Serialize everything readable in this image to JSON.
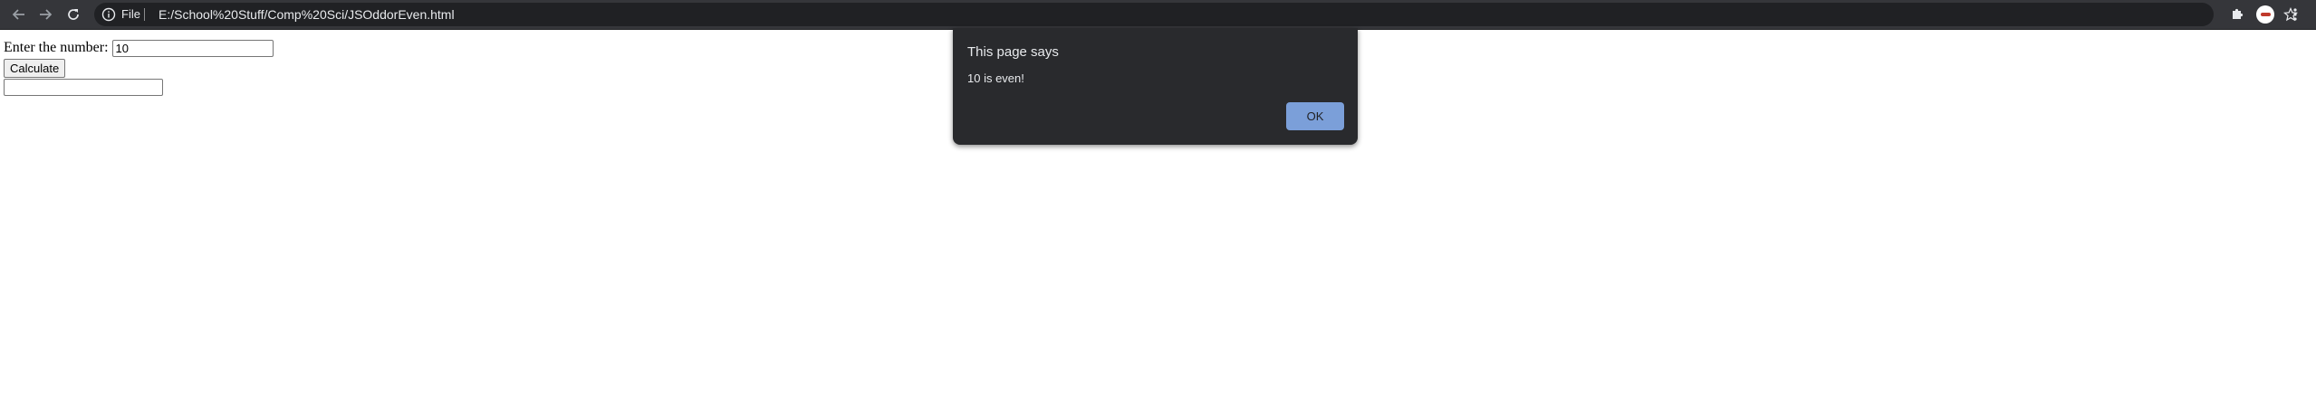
{
  "browser": {
    "file_label": "File",
    "url": "E:/School%20Stuff/Comp%20Sci/JSOddorEven.html"
  },
  "page": {
    "prompt_label": "Enter the number:",
    "number_value": "10",
    "calculate_label": "Calculate",
    "result_value": ""
  },
  "dialog": {
    "title": "This page says",
    "message": "10 is even!",
    "ok_label": "OK"
  },
  "colors": {
    "toolbar": "#35363a",
    "omnibox": "#202124",
    "dialog_bg": "#292a2d",
    "ok_button": "#8ab4f8"
  },
  "icons": [
    "back-arrow-icon",
    "forward-arrow-icon",
    "reload-icon",
    "info-icon",
    "star-icon",
    "extensions-puzzle-icon",
    "profile-avatar",
    "kebab-menu-icon"
  ]
}
